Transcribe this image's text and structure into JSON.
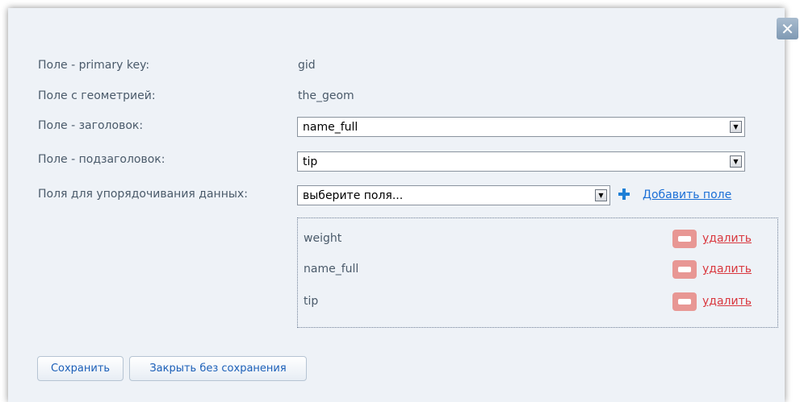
{
  "close": {
    "symbol": "✕"
  },
  "form": {
    "rows": [
      {
        "label": "Поле - primary key:",
        "value": "gid"
      },
      {
        "label": "Поле с геометрией:",
        "value": "the_geom"
      },
      {
        "label": "Поле - заголовок:",
        "value": "name_full"
      },
      {
        "label": "Поле - подзаголовок:",
        "value": "tip"
      },
      {
        "label": "Поля для упорядочивания данных:",
        "value": "выберите поля..."
      }
    ],
    "add_field_label": "Добавить поле",
    "order_fields": [
      {
        "name": "weight",
        "delete_label": "удалить"
      },
      {
        "name": "name_full",
        "delete_label": "удалить"
      },
      {
        "name": "tip",
        "delete_label": "удалить"
      }
    ]
  },
  "buttons": {
    "save": "Сохранить",
    "close_without_save": "Закрыть без сохранения"
  },
  "icons": {
    "close": "close-icon",
    "add": "plus-icon",
    "remove": "minus-icon",
    "dropdown": "chevron-down-icon"
  },
  "colors": {
    "dialog_bg": "#eef2f7",
    "link": "#1b6fd6",
    "delete_link": "#d9383f",
    "delete_icon": "#e89794",
    "add_icon": "#1e7fd6"
  }
}
